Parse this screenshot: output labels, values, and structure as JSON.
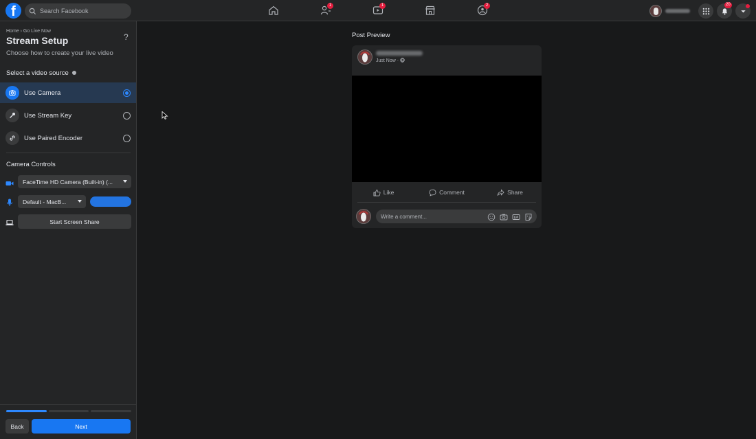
{
  "header": {
    "search_placeholder": "Search Facebook",
    "nav": [
      {
        "name": "home",
        "badge": ""
      },
      {
        "name": "friends",
        "badge": "1"
      },
      {
        "name": "watch",
        "badge": "1"
      },
      {
        "name": "marketplace",
        "badge": ""
      },
      {
        "name": "groups",
        "badge": "2"
      }
    ],
    "notifications_badge": "20"
  },
  "setup": {
    "breadcrumb": "Home › Go Live Now",
    "help": "?",
    "title": "Stream Setup",
    "subtitle": "Choose how to create your live video",
    "source_label": "Select a video source",
    "sources": [
      {
        "label": "Use Camera",
        "selected": true
      },
      {
        "label": "Use Stream Key",
        "selected": false
      },
      {
        "label": "Use Paired Encoder",
        "selected": false
      }
    ],
    "camera_controls_label": "Camera Controls",
    "camera_select": "FaceTime HD Camera (Built-in) (...",
    "mic_select": "Default - MacB...",
    "screen_share_label": "Start Screen Share",
    "progress_steps": 3,
    "progress_current": 1,
    "back_label": "Back",
    "next_label": "Next"
  },
  "preview": {
    "label": "Post Preview",
    "time": "Just Now · ",
    "actions": {
      "like": "Like",
      "comment": "Comment",
      "share": "Share"
    },
    "comment_placeholder": "Write a comment..."
  },
  "colors": {
    "accent": "#1877f2",
    "background": "#18191a",
    "panel": "#242526",
    "badge": "#e41e3f"
  }
}
